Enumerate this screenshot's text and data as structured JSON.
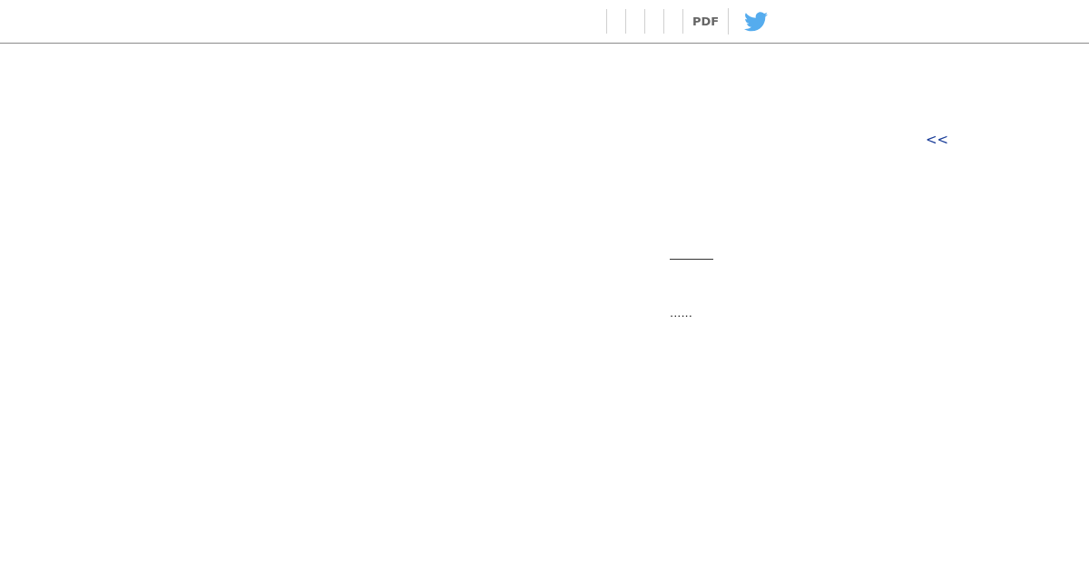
{
  "toolbar": {
    "pdf_link": "PDF"
  },
  "back_link": "<<",
  "ellipsis": "......"
}
